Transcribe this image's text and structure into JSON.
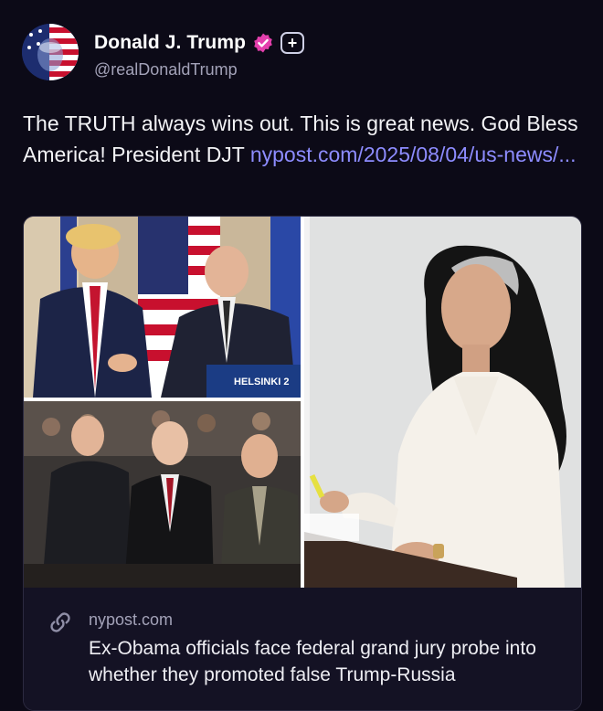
{
  "author": {
    "display_name": "Donald J. Trump",
    "handle": "@realDonaldTrump",
    "avatar_icon": "flag-portrait-avatar",
    "verified_icon": "verified-badge-icon",
    "verified_color": "#e43fad",
    "plus_badge_label": "+"
  },
  "post": {
    "text": "The TRUTH always wins out. This is great news. God Bless America! President DJT ",
    "link_text": "nypost.com/2025/08/04/us-news/...",
    "link_color": "#8d8cff"
  },
  "media": {
    "image_description_icon": "photo-collage",
    "podium_text": "HELSINKI 2"
  },
  "link_card": {
    "icon": "link-icon",
    "domain": "nypost.com",
    "title": "Ex-Obama officials face federal grand jury probe into whether they promoted false Trump-Russia"
  }
}
